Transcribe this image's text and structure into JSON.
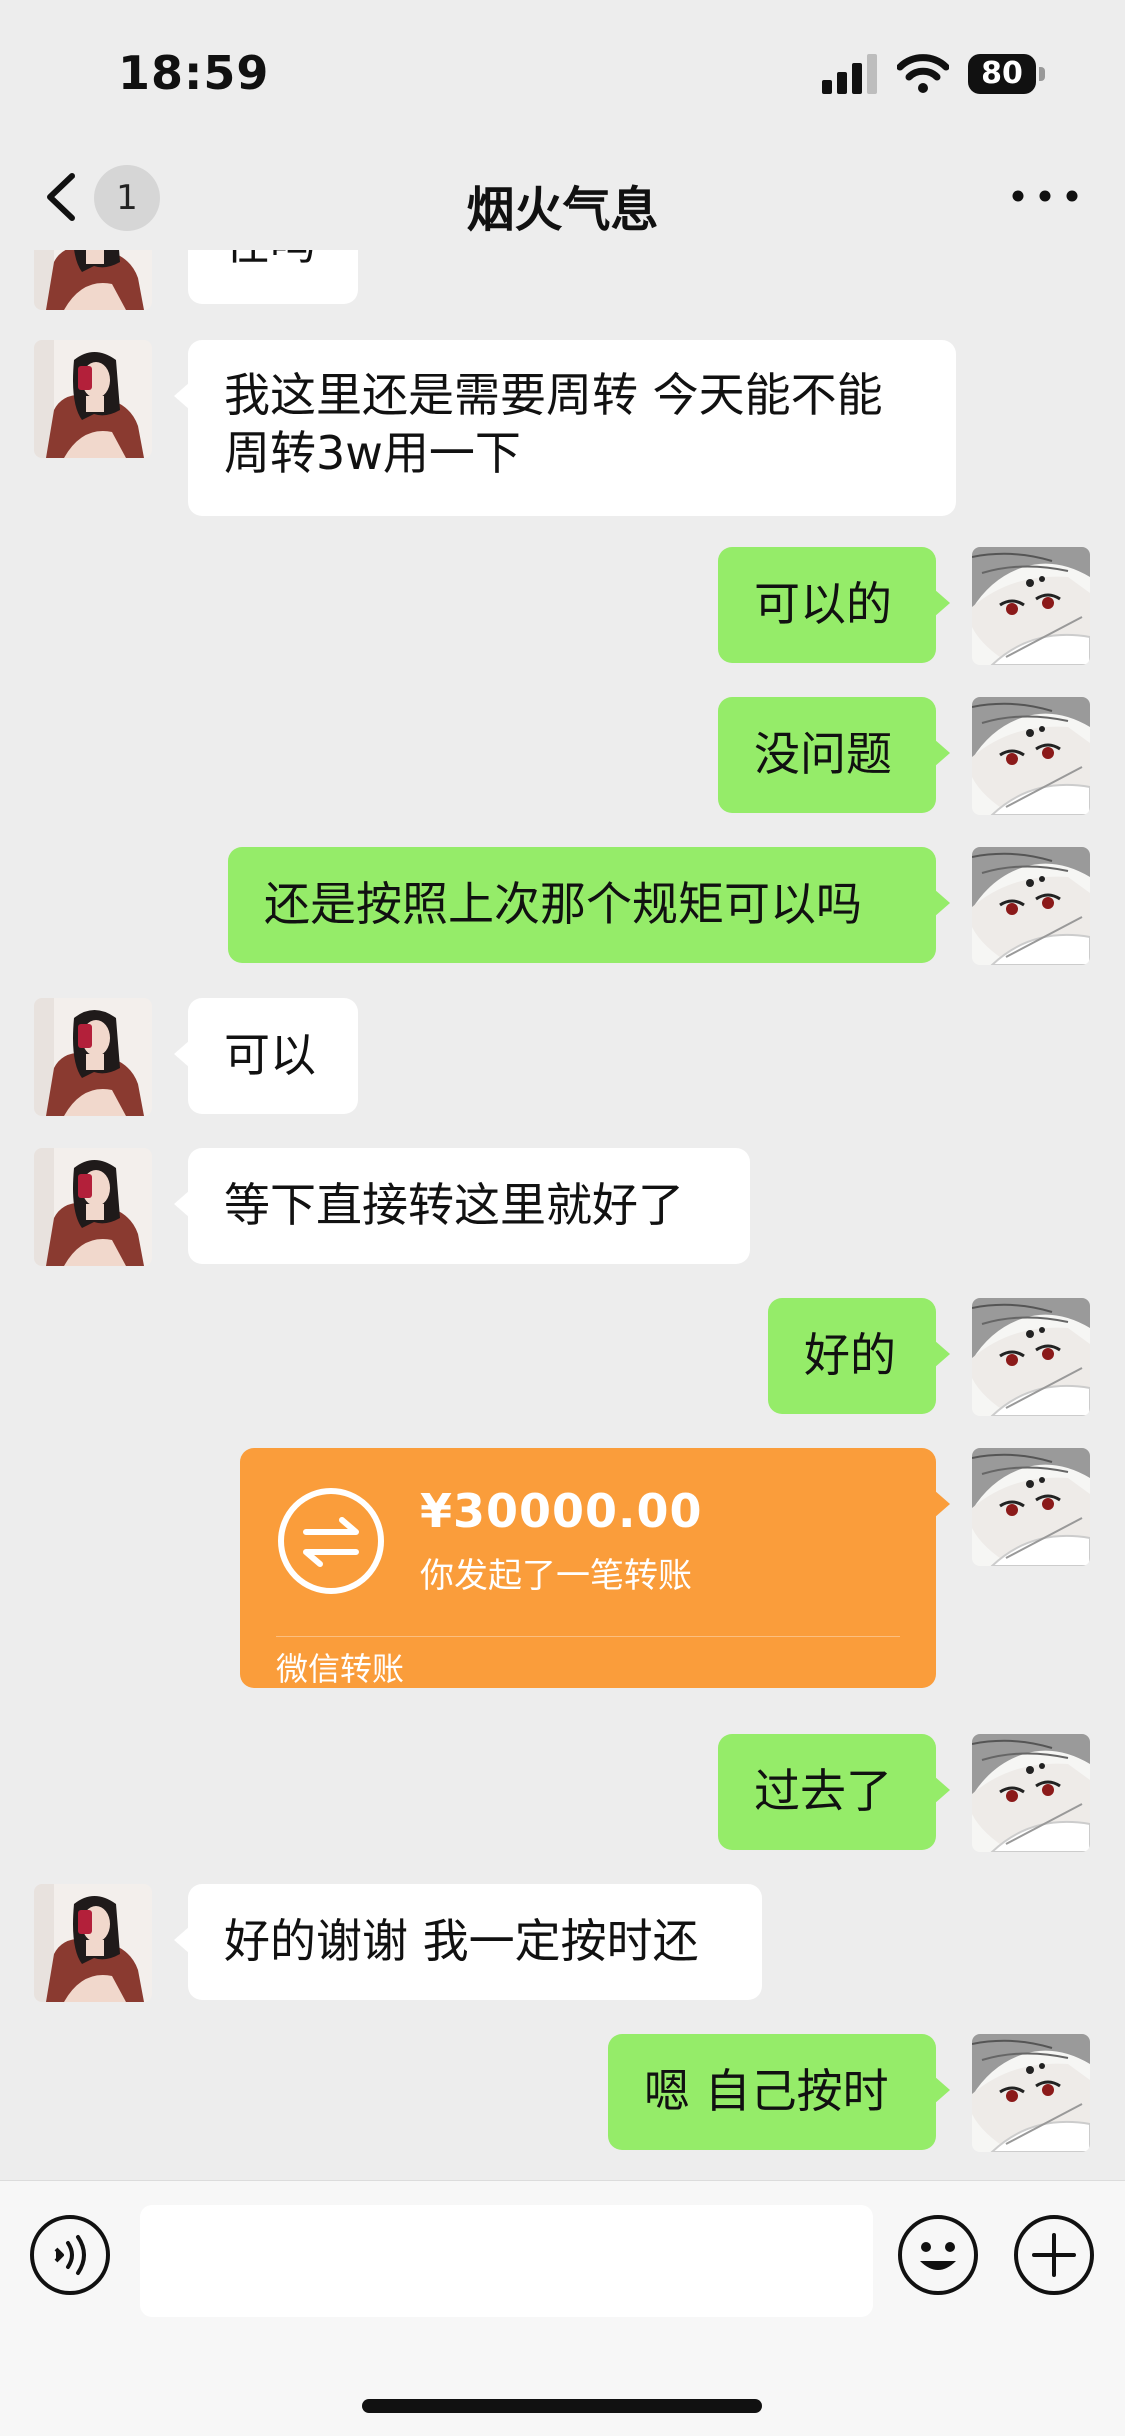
{
  "status_bar": {
    "time": "18:59",
    "battery": "80"
  },
  "nav": {
    "unread_count": "1",
    "title": "烟火气息"
  },
  "messages": {
    "partial": "在吗",
    "m1_line1": "我这里还是需要周转 今天能不能",
    "m1_line2": "周转3w用一下",
    "m2": "可以的",
    "m3": "没问题",
    "m4": "还是按照上次那个规矩可以吗",
    "m5": "可以",
    "m6": "等下直接转这里就好了",
    "m7": "好的",
    "m9": "过去了",
    "m10": "好的谢谢 我一定按时还",
    "m11": "嗯 自己按时"
  },
  "transfer": {
    "amount": "¥30000.00",
    "description": "你发起了一笔转账",
    "label": "微信转账"
  },
  "colors": {
    "background": "#ededed",
    "bubble_self": "#95ec69",
    "bubble_other": "#ffffff",
    "transfer_card": "#fa9d3b"
  }
}
